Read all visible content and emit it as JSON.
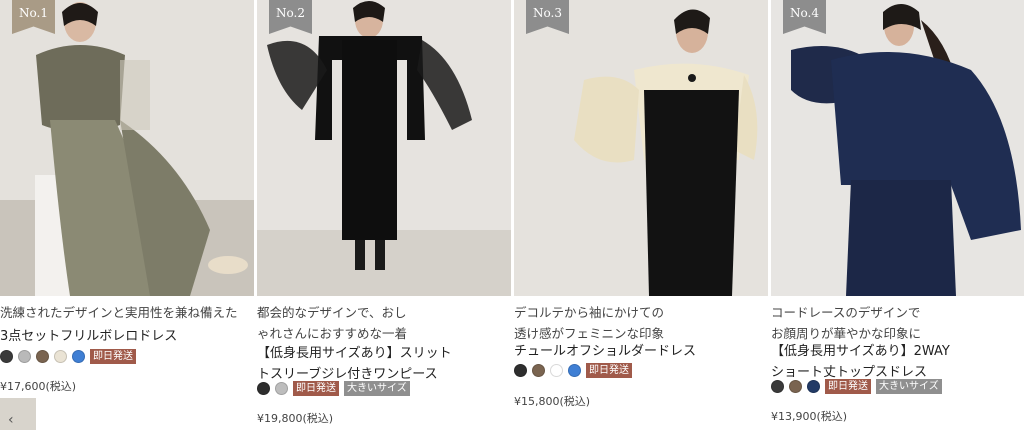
{
  "products": [
    {
      "rank": "No.1",
      "description_lines": [
        "洗練されたデザインと実用性を兼ね備えた"
      ],
      "name_lines": [
        "3点セットフリルボレロドレス"
      ],
      "swatches": [
        "#3a3a3a",
        "#b9b9b9",
        "#7a6450",
        "#eae3d4",
        "#3f7fd4"
      ],
      "badges": [
        {
          "label": "即日発送",
          "tone": "red"
        }
      ],
      "price": "¥17,600(税込)"
    },
    {
      "rank": "No.2",
      "description_lines": [
        "都会的なデザインで、おし",
        "ゃれさんにおすすめな一着"
      ],
      "name_lines": [
        "【低身長用サイズあり】スリット",
        "トスリーブジレ付きワンピース"
      ],
      "swatches": [
        "#2e2e2e",
        "#bdbdbd"
      ],
      "badges": [
        {
          "label": "即日発送",
          "tone": "red"
        },
        {
          "label": "大きいサイズ",
          "tone": "gray"
        }
      ],
      "price": "¥19,800(税込)"
    },
    {
      "rank": "No.3",
      "description_lines": [
        "デコルテから袖にかけての",
        "透け感がフェミニンな印象"
      ],
      "name_lines": [
        "チュールオフショルダードレス"
      ],
      "swatches": [
        "#2e2e2e",
        "#7a6450",
        "#ffffff",
        "#3f7fd4"
      ],
      "badges": [
        {
          "label": "即日発送",
          "tone": "red"
        }
      ],
      "price": "¥15,800(税込)"
    },
    {
      "rank": "No.4",
      "description_lines": [
        "コードレースのデザインで",
        "お顔周りが華やかな印象に"
      ],
      "name_lines": [
        "【低身長用サイズあり】2WAY",
        "ショート丈トップスドレス"
      ],
      "swatches": [
        "#3a3a3a",
        "#7a6450",
        "#223a66"
      ],
      "badges": [
        {
          "label": "即日発送",
          "tone": "red"
        },
        {
          "label": "大きいサイズ",
          "tone": "gray"
        }
      ],
      "price": "¥13,900(税込)"
    }
  ],
  "nav": {
    "prev_glyph": "‹"
  }
}
